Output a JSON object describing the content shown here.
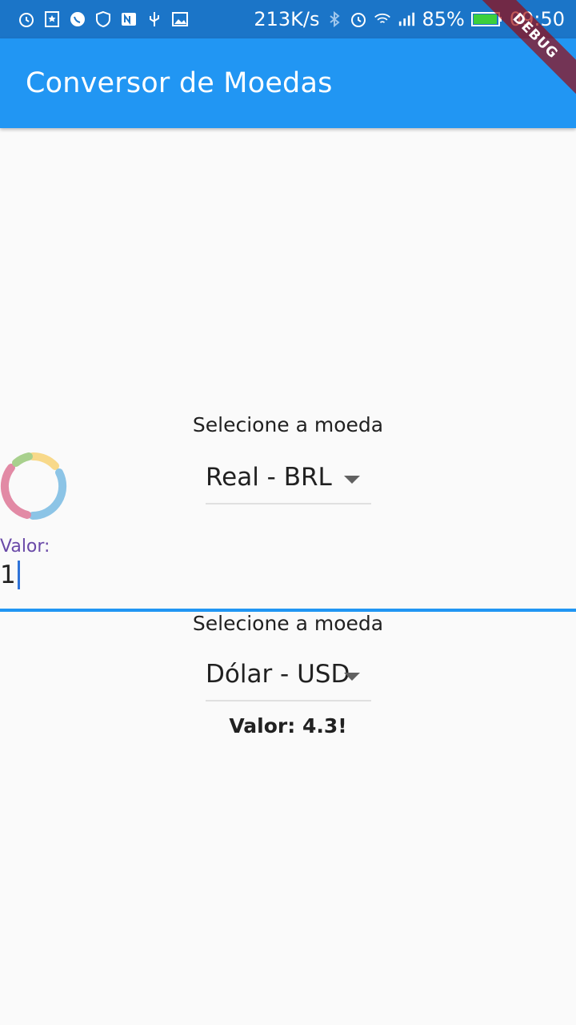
{
  "status_bar": {
    "speed": "213K/s",
    "battery_percent": "85%",
    "time": "09:50",
    "left_icons": [
      "alarm-icon",
      "bookmark-star-icon",
      "whatsapp-icon",
      "shield-icon",
      "n-app-icon",
      "usb-icon",
      "image-icon"
    ],
    "right_icons": [
      "bluetooth-icon",
      "alarm-icon",
      "wifi-icon",
      "signal-icon",
      "battery-icon"
    ]
  },
  "app_bar": {
    "title": "Conversor de Moedas",
    "color": "#2196f3"
  },
  "debug_banner": "DEBUG",
  "from": {
    "prompt": "Selecione a moeda",
    "selected": "Real - BRL"
  },
  "input": {
    "label": "Valor:",
    "value": "1"
  },
  "to": {
    "prompt": "Selecione a moeda",
    "selected": "Dólar - USD"
  },
  "result": "Valor: 4.3!"
}
